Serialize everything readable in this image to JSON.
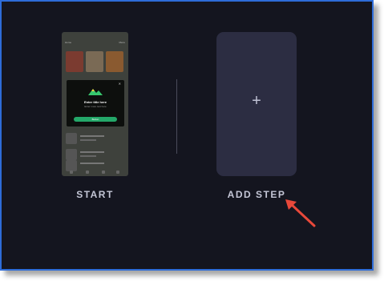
{
  "start_card": {
    "label": "START",
    "thumbnail": {
      "header_left": "Home",
      "header_right": "Menu",
      "popup": {
        "close": "✕",
        "title": "Enter title here",
        "subtitle": "Enter more text here",
        "button": "Button"
      }
    }
  },
  "add_card": {
    "plus": "+",
    "label": "ADD STEP"
  },
  "colors": {
    "background": "#14151f",
    "card": "#2c2d42",
    "frame_border": "#2e6cd8",
    "arrow": "#e8483a",
    "accent_green": "#24a869"
  }
}
